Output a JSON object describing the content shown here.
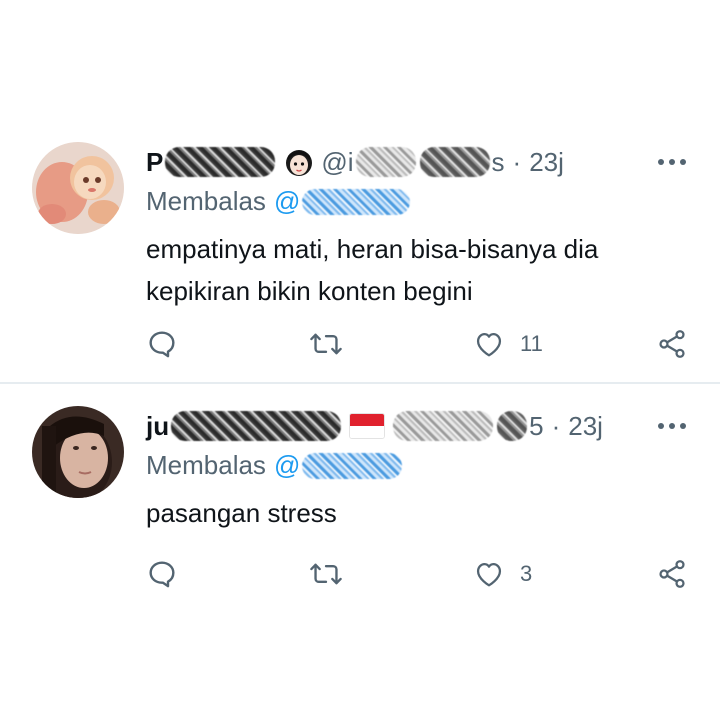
{
  "colors": {
    "text_primary": "#0f1419",
    "text_secondary": "#536471",
    "link": "#1d9bf0",
    "divider": "#e6ecf0",
    "flag_red": "#e0212d"
  },
  "replies": [
    {
      "name_visible": "P",
      "handle_visible": "@i",
      "handle_end_visible": "s",
      "time": "23j",
      "replying_prefix": "Membalas",
      "mention_visible": "@",
      "text_line1": "empatinya mati, heran bisa-bisanya dia",
      "text_line2": "kepikiran bikin konten begini",
      "like_count": "11",
      "icons": [
        "reply-icon",
        "retweet-icon",
        "like-icon",
        "share-icon",
        "more-icon",
        "girl-face-emoji-icon"
      ]
    },
    {
      "name_visible": "ju",
      "handle_end_visible": "5",
      "time": "23j",
      "replying_prefix": "Membalas",
      "mention_visible": "@",
      "text_line1": "pasangan stress",
      "like_count": "3",
      "icons": [
        "reply-icon",
        "retweet-icon",
        "like-icon",
        "share-icon",
        "more-icon",
        "indonesia-flag-icon"
      ]
    }
  ]
}
